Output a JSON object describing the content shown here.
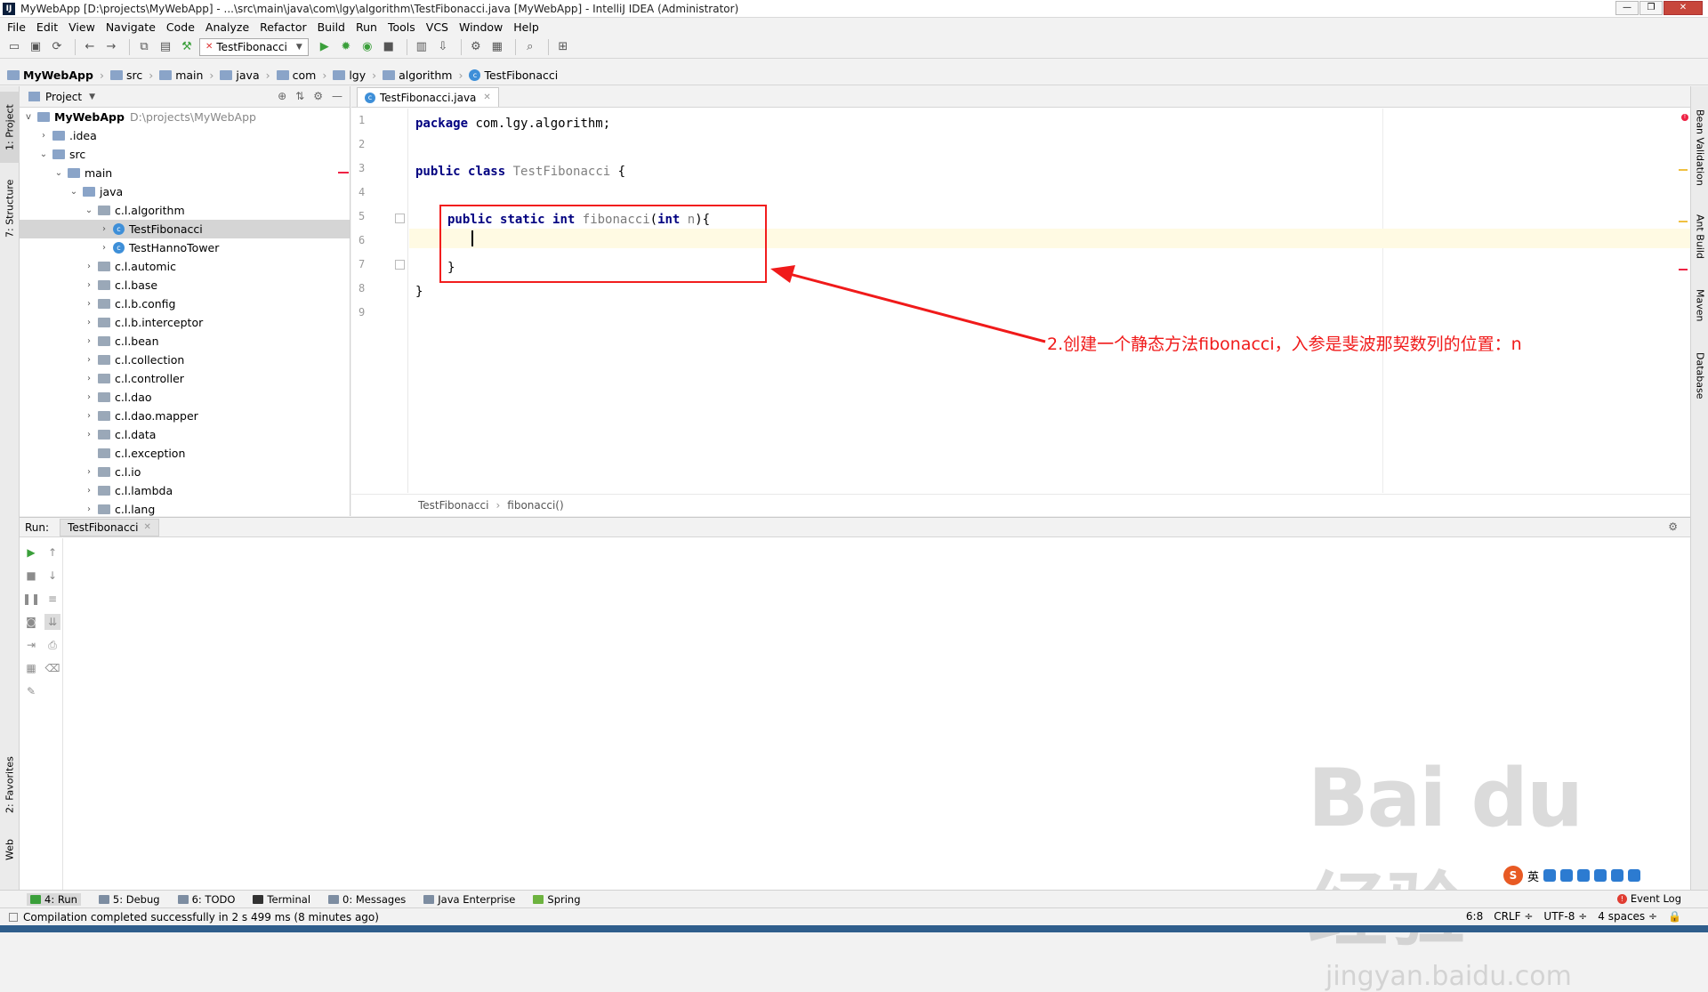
{
  "window": {
    "title": "MyWebApp [D:\\projects\\MyWebApp] - ...\\src\\main\\java\\com\\lgy\\algorithm\\TestFibonacci.java [MyWebApp] - IntelliJ IDEA (Administrator)",
    "logo": "IJ"
  },
  "menu": [
    "File",
    "Edit",
    "View",
    "Navigate",
    "Code",
    "Analyze",
    "Refactor",
    "Build",
    "Run",
    "Tools",
    "VCS",
    "Window",
    "Help"
  ],
  "toolbar": {
    "run_config": "TestFibonacci"
  },
  "breadcrumbs": [
    "MyWebApp",
    "src",
    "main",
    "java",
    "com",
    "lgy",
    "algorithm",
    "TestFibonacci"
  ],
  "left_tabs": {
    "project": "1: Project",
    "structure": "7: Structure",
    "favorites": "2: Favorites",
    "web": "Web"
  },
  "project_panel": {
    "title": "Project",
    "root": {
      "label": "MyWebApp",
      "path": "D:\\projects\\MyWebApp"
    },
    "items": [
      {
        "label": ".idea",
        "depth": 1,
        "expand": ">",
        "icon": "folder"
      },
      {
        "label": "src",
        "depth": 1,
        "expand": "v",
        "icon": "folder"
      },
      {
        "label": "main",
        "depth": 2,
        "expand": "v",
        "icon": "folder"
      },
      {
        "label": "java",
        "depth": 3,
        "expand": "v",
        "icon": "folder"
      },
      {
        "label": "c.l.algorithm",
        "depth": 4,
        "expand": "v",
        "icon": "package"
      },
      {
        "label": "TestFibonacci",
        "depth": 5,
        "expand": ">",
        "icon": "class",
        "selected": true
      },
      {
        "label": "TestHannoTower",
        "depth": 5,
        "expand": ">",
        "icon": "class"
      },
      {
        "label": "c.l.automic",
        "depth": 4,
        "expand": ">",
        "icon": "package"
      },
      {
        "label": "c.l.base",
        "depth": 4,
        "expand": ">",
        "icon": "package"
      },
      {
        "label": "c.l.b.config",
        "depth": 4,
        "expand": ">",
        "icon": "package"
      },
      {
        "label": "c.l.b.interceptor",
        "depth": 4,
        "expand": ">",
        "icon": "package"
      },
      {
        "label": "c.l.bean",
        "depth": 4,
        "expand": ">",
        "icon": "package"
      },
      {
        "label": "c.l.collection",
        "depth": 4,
        "expand": ">",
        "icon": "package"
      },
      {
        "label": "c.l.controller",
        "depth": 4,
        "expand": ">",
        "icon": "package"
      },
      {
        "label": "c.l.dao",
        "depth": 4,
        "expand": ">",
        "icon": "package"
      },
      {
        "label": "c.l.dao.mapper",
        "depth": 4,
        "expand": ">",
        "icon": "package"
      },
      {
        "label": "c.l.data",
        "depth": 4,
        "expand": ">",
        "icon": "package"
      },
      {
        "label": "c.l.exception",
        "depth": 4,
        "expand": "",
        "icon": "package"
      },
      {
        "label": "c.l.io",
        "depth": 4,
        "expand": ">",
        "icon": "package"
      },
      {
        "label": "c.l.lambda",
        "depth": 4,
        "expand": ">",
        "icon": "package"
      },
      {
        "label": "c.l.lang",
        "depth": 4,
        "expand": ">",
        "icon": "package"
      }
    ]
  },
  "editor": {
    "tab": "TestFibonacci.java",
    "line_numbers": [
      "1",
      "2",
      "3",
      "4",
      "5",
      "6",
      "7",
      "8",
      "9"
    ],
    "code": {
      "l1_kw": "package",
      "l1_rest": " com.lgy.algorithm;",
      "l3_kw1": "public",
      "l3_kw2": "class",
      "l3_name": "TestFibonacci",
      "l3_brace": " {",
      "l5_kw1": "public",
      "l5_kw2": "static",
      "l5_kw3": "int",
      "l5_name": "fibonacci",
      "l5_open": "(",
      "l5_kw4": "int",
      "l5_param": " n",
      "l5_close": "){",
      "l7": "}",
      "l8": "}"
    },
    "breadcrumb": [
      "TestFibonacci",
      "fibonacci()"
    ]
  },
  "annotation": "2.创建一个静态方法fibonacci，入参是斐波那契数列的位置：n",
  "right_tabs": [
    "Bean Validation",
    "Ant Build",
    "Maven",
    "Database"
  ],
  "run_panel": {
    "label": "Run:",
    "tab": "TestFibonacci"
  },
  "bottom_tabs": [
    "4: Run",
    "5: Debug",
    "6: TODO",
    "Terminal",
    "0: Messages",
    "Java Enterprise",
    "Spring"
  ],
  "event_log": "Event Log",
  "status": {
    "message": "Compilation completed successfully in 2 s 499 ms (8 minutes ago)",
    "position": "6:8",
    "line_sep": "CRLF ÷",
    "encoding": "UTF-8 ÷",
    "indent": "4 spaces ÷"
  },
  "ime": {
    "logo": "S",
    "mode": "英"
  },
  "watermark": {
    "brand": "Bai du 经验",
    "url": "jingyan.baidu.com"
  },
  "colors": {
    "annotation_red": "#f01a1a",
    "keyword": "#000080",
    "current_line": "#fffae3",
    "selection": "#d5d5d5"
  }
}
